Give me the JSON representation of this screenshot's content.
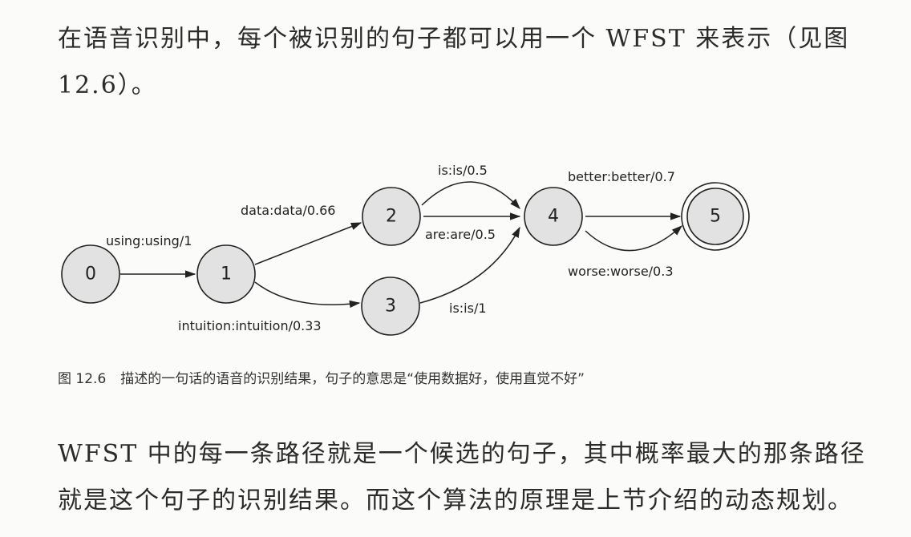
{
  "paragraphs": {
    "p1": "在语音识别中，每个被识别的句子都可以用一个 WFST 来表示（见图 12.6）。",
    "p2": "WFST 中的每一条路径就是一个候选的句子，其中概率最大的那条路径就是这个句子的识别结果。而这个算法的原理是上节介绍的动态规划。"
  },
  "figure": {
    "number": "图 12.6",
    "caption": "描述的一句话的语音的识别结果，句子的意思是“使用数据好，使用直觉不好”",
    "nodes": [
      "0",
      "1",
      "2",
      "3",
      "4",
      "5"
    ],
    "edges": [
      {
        "from": "0",
        "to": "1",
        "label": "using:using/1"
      },
      {
        "from": "1",
        "to": "2",
        "label": "data:data/0.66"
      },
      {
        "from": "1",
        "to": "3",
        "label": "intuition:intuition/0.33"
      },
      {
        "from": "2",
        "to": "4",
        "label": "is:is/0.5"
      },
      {
        "from": "2",
        "to": "4",
        "label": "are:are/0.5"
      },
      {
        "from": "3",
        "to": "4",
        "label": "is:is/1"
      },
      {
        "from": "4",
        "to": "5",
        "label": "better:better/0.7"
      },
      {
        "from": "4",
        "to": "5",
        "label": "worse:worse/0.3"
      }
    ],
    "final_state": "5"
  }
}
